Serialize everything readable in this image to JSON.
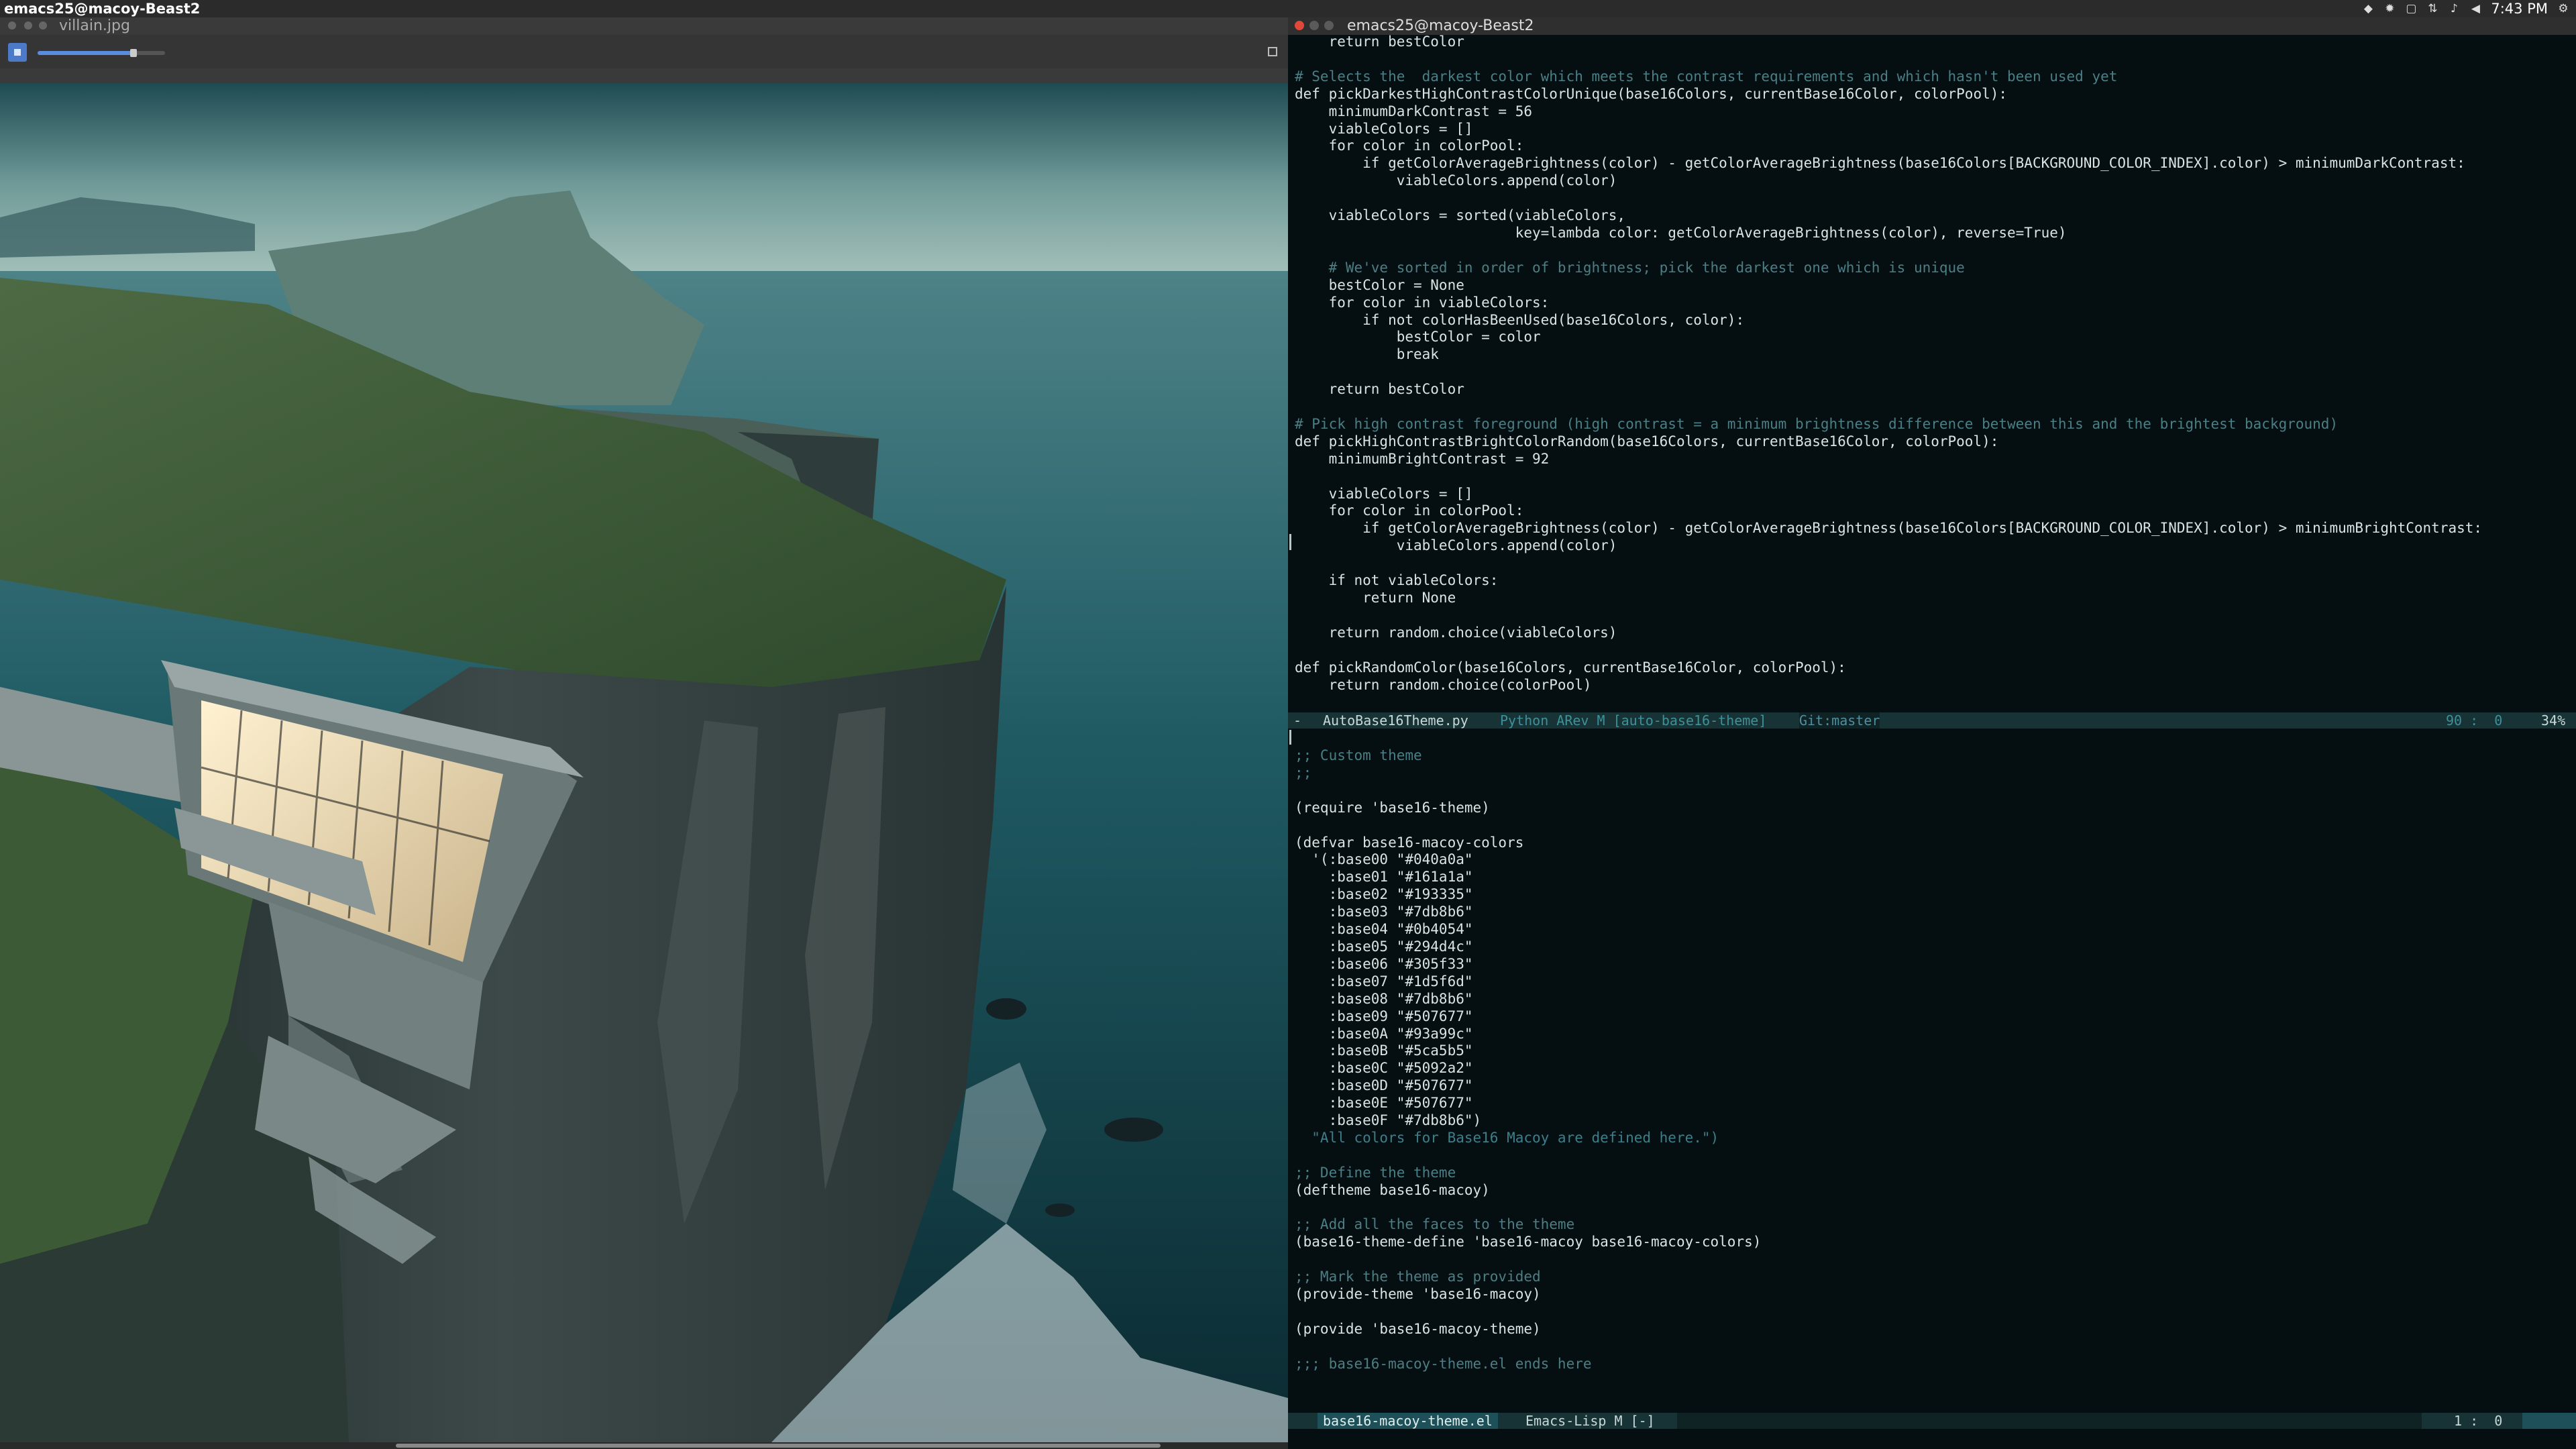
{
  "topbar": {
    "title": "emacs25@macoy-Beast2",
    "clock": "7:43 PM",
    "tray_icons": [
      "dropbox-icon",
      "steam-icon",
      "window-icon",
      "network-icon",
      "bell-icon",
      "volume-icon",
      "search-icon"
    ]
  },
  "viewer": {
    "filename": "villain.jpg",
    "zoom_level": 0.75
  },
  "emacs": {
    "title": "emacs25@macoy-Beast2",
    "colors": {
      "bg": "#050e10",
      "comment": "#4b7f86",
      "modeline": "#173336"
    },
    "top_lines": [
      "    return bestColor",
      "",
      "# Selects the  darkest color which meets the contrast requirements and which hasn't been used yet",
      "def pickDarkestHighContrastColorUnique(base16Colors, currentBase16Color, colorPool):",
      "    minimumDarkContrast = 56",
      "    viableColors = []",
      "    for color in colorPool:",
      "        if getColorAverageBrightness(color) - getColorAverageBrightness(base16Colors[BACKGROUND_COLOR_INDEX].color) > minimumDarkContrast:",
      "            viableColors.append(color)",
      "",
      "    viableColors = sorted(viableColors,",
      "                          key=lambda color: getColorAverageBrightness(color), reverse=True)",
      "",
      "    # We've sorted in order of brightness; pick the darkest one which is unique",
      "    bestColor = None",
      "    for color in viableColors:",
      "        if not colorHasBeenUsed(base16Colors, color):",
      "            bestColor = color",
      "            break",
      "",
      "    return bestColor",
      "",
      "# Pick high contrast foreground (high contrast = a minimum brightness difference between this and the brightest background)",
      "def pickHighContrastBrightColorRandom(base16Colors, currentBase16Color, colorPool):",
      "    minimumBrightContrast = 92",
      "",
      "    viableColors = []",
      "    for color in colorPool:",
      "        if getColorAverageBrightness(color) - getColorAverageBrightness(base16Colors[BACKGROUND_COLOR_INDEX].color) > minimumBrightContrast:",
      "            viableColors.append(color)",
      "",
      "    if not viableColors:",
      "        return None",
      "",
      "    return random.choice(viableColors)",
      "",
      "def pickRandomColor(base16Colors, currentBase16Color, colorPool):",
      "    return random.choice(colorPool)"
    ],
    "modeline_top": {
      "marker": "-",
      "buffer": "AutoBase16Theme.py",
      "mode": "Python ARev M [auto-base16-theme]",
      "git": "Git:master",
      "position": "90 :  0",
      "percent": "34%"
    },
    "bottom_lines": [
      ";; Custom theme",
      ";;",
      "",
      "(require 'base16-theme)",
      "",
      "(defvar base16-macoy-colors",
      "  '(:base00 \"#040a0a\"",
      "    :base01 \"#161a1a\"",
      "    :base02 \"#193335\"",
      "    :base03 \"#7db8b6\"",
      "    :base04 \"#0b4054\"",
      "    :base05 \"#294d4c\"",
      "    :base06 \"#305f33\"",
      "    :base07 \"#1d5f6d\"",
      "    :base08 \"#7db8b6\"",
      "    :base09 \"#507677\"",
      "    :base0A \"#93a99c\"",
      "    :base0B \"#5ca5b5\"",
      "    :base0C \"#5092a2\"",
      "    :base0D \"#507677\"",
      "    :base0E \"#507677\"",
      "    :base0F \"#7db8b6\")",
      "  \"All colors for Base16 Macoy are defined here.\")",
      "",
      ";; Define the theme",
      "(deftheme base16-macoy)",
      "",
      ";; Add all the faces to the theme",
      "(base16-theme-define 'base16-macoy base16-macoy-colors)",
      "",
      ";; Mark the theme as provided",
      "(provide-theme 'base16-macoy)",
      "",
      "(provide 'base16-macoy-theme)",
      "",
      ";;; base16-macoy-theme.el ends here"
    ],
    "modeline_bottom": {
      "buffer": "base16-macoy-theme.el",
      "mode": "Emacs-Lisp M [-]",
      "position": "1 :  0"
    }
  }
}
